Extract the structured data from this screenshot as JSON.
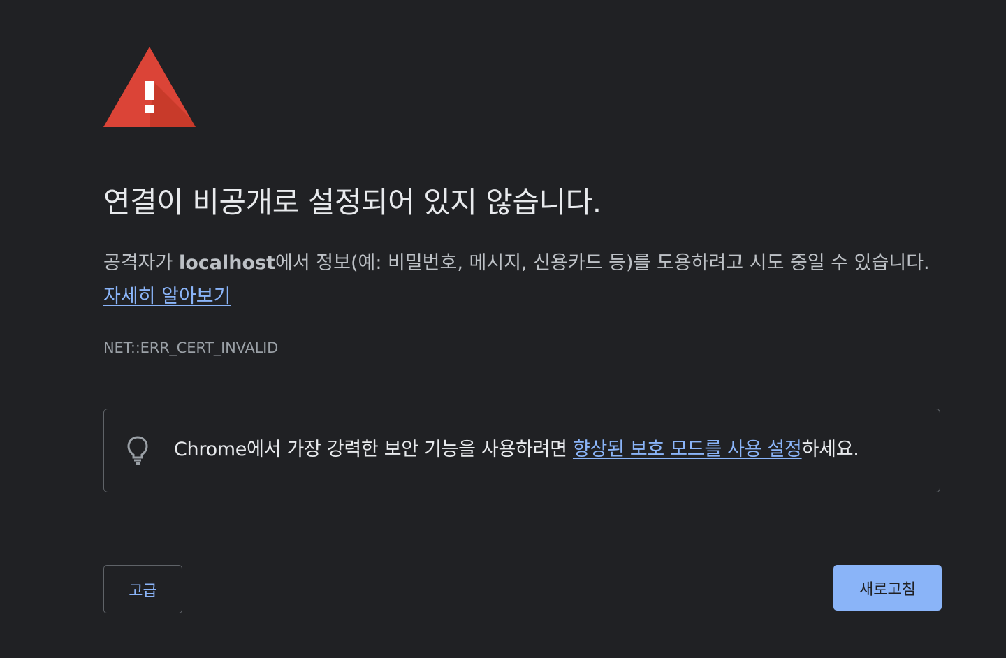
{
  "warning": {
    "icon": "warning-triangle-icon",
    "color": "#db4437"
  },
  "heading": "연결이 비공개로 설정되어 있지 않습니다.",
  "description": {
    "prefix": "공격자가 ",
    "host": "localhost",
    "suffix": "에서 정보(예: 비밀번호, 메시지, 신용카드 등)를 도용하려고 시도 중일 수 있습니다. ",
    "learn_more": "자세히 알아보기"
  },
  "error_code": "NET::ERR_CERT_INVALID",
  "infobox": {
    "icon": "lightbulb-icon",
    "prefix": "Chrome에서 가장 강력한 보안 기능을 사용하려면 ",
    "link": "향상된 보호 모드를 사용 설정",
    "suffix": "하세요."
  },
  "buttons": {
    "advanced": "고급",
    "reload": "새로고침"
  },
  "colors": {
    "background": "#202124",
    "link": "#8ab4f8",
    "primary_button": "#8ab4f8"
  }
}
